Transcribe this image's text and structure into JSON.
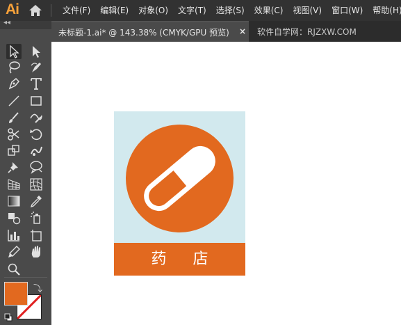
{
  "app": {
    "logo_text": "Ai"
  },
  "menubar": {
    "items": [
      "文件(F)",
      "编辑(E)",
      "对象(O)",
      "文字(T)",
      "选择(S)",
      "效果(C)",
      "视图(V)",
      "窗口(W)",
      "帮助(H)"
    ]
  },
  "document_tab": {
    "title": "未标题-1.ai* @ 143.38% (CMYK/GPU 预览)",
    "close": "×",
    "site": "软件自学网：RJZXW.COM"
  },
  "toolbar": {
    "collapse": "◂◂",
    "tools": [
      "selection-icon",
      "direct-selection-icon",
      "lasso-icon",
      "curvature-icon",
      "pen-icon",
      "type-icon",
      "line-segment-icon",
      "rectangle-icon",
      "paintbrush-icon",
      "shaper-icon",
      "scissors-icon",
      "rotate-icon",
      "scale-icon",
      "warp-icon",
      "pin-icon",
      "chat-bubble-icon",
      "perspective-grid-icon",
      "mesh-icon",
      "gradient-icon",
      "eyedropper-icon",
      "blend-icon",
      "symbol-sprayer-icon",
      "column-graph-icon",
      "artboard-icon",
      "slice-icon",
      "hand-icon",
      "zoom-icon"
    ]
  },
  "colors": {
    "fill": "#e2691f",
    "stroke": "none"
  },
  "canvas": {
    "artwork": {
      "banner_text": "药店",
      "background": "#d2e9ee",
      "accent": "#e2691f"
    }
  }
}
